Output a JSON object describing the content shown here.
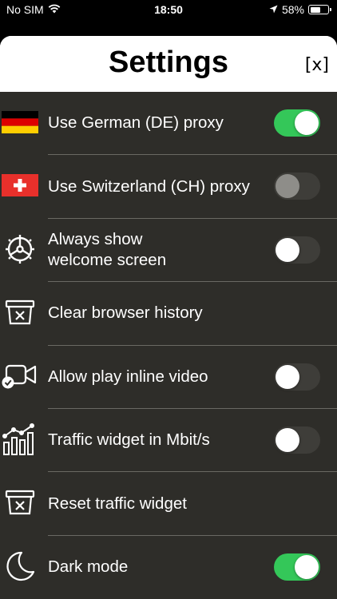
{
  "status_bar": {
    "carrier": "No SIM",
    "time": "18:50",
    "battery_percent": "58%",
    "battery_level": 0.58
  },
  "header": {
    "title": "Settings",
    "close_label": "[x]"
  },
  "settings": [
    {
      "label": "Use German (DE) proxy",
      "icon": "germany-flag-icon",
      "toggle": "on"
    },
    {
      "label": "Use Switzerland (CH) proxy",
      "icon": "switzerland-flag-icon",
      "toggle": "disabled"
    },
    {
      "label": "Always show\nwelcome screen",
      "icon": "steering-wheel-icon",
      "toggle": "off"
    },
    {
      "label": "Clear browser history",
      "icon": "clear-history-icon",
      "toggle": null
    },
    {
      "label": "Allow play inline video",
      "icon": "video-camera-check-icon",
      "toggle": "off"
    },
    {
      "label": "Traffic widget in Mbit/s",
      "icon": "bar-chart-icon",
      "toggle": "off"
    },
    {
      "label": "Reset traffic widget",
      "icon": "reset-widget-icon",
      "toggle": null
    },
    {
      "label": "Dark mode",
      "icon": "moon-icon",
      "toggle": "on"
    }
  ],
  "colors": {
    "toggle_on": "#34c759",
    "list_background": "#2e2d29",
    "divider": "#6a6963"
  }
}
